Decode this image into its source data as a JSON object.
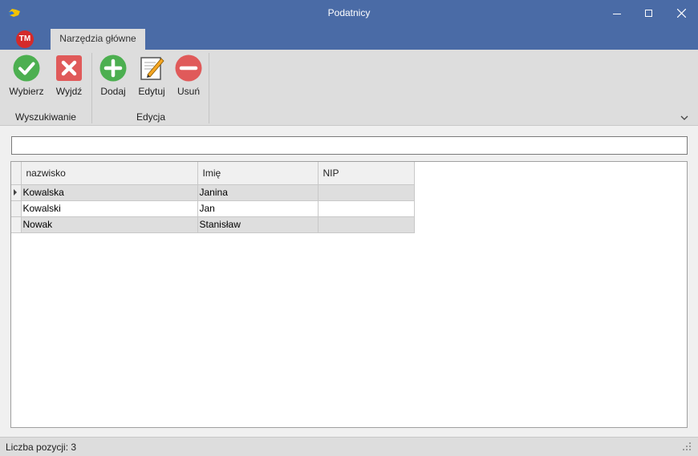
{
  "window": {
    "title": "Podatnicy",
    "icon": "app-icon",
    "controls": [
      "minimize-icon",
      "maximize-icon",
      "close-icon"
    ]
  },
  "ribbon": {
    "app_logo": "TM",
    "tabs": [
      {
        "label": "Narzędzia główne",
        "active": true
      }
    ],
    "groups": [
      {
        "label": "Wyszukiwanie",
        "buttons": [
          {
            "label": "Wybierz",
            "icon": "check-icon",
            "color": "#4caf50"
          },
          {
            "label": "Wyjdź",
            "icon": "close-x-icon",
            "color": "#e05a5a"
          }
        ]
      },
      {
        "label": "Edycja",
        "buttons": [
          {
            "label": "Dodaj",
            "icon": "plus-icon",
            "color": "#4caf50"
          },
          {
            "label": "Edytuj",
            "icon": "edit-pencil-icon",
            "color": "#f5a623"
          },
          {
            "label": "Usuń",
            "icon": "minus-icon",
            "color": "#e05a5a"
          }
        ]
      }
    ]
  },
  "search": {
    "value": "",
    "placeholder": ""
  },
  "grid": {
    "columns": [
      "nazwisko",
      "Imię",
      "NIP"
    ],
    "rows": [
      {
        "nazwisko": "Kowalska",
        "imie": "Janina",
        "nip": "",
        "current": true
      },
      {
        "nazwisko": "Kowalski",
        "imie": "Jan",
        "nip": ""
      },
      {
        "nazwisko": "Nowak",
        "imie": "Stanisław",
        "nip": ""
      }
    ]
  },
  "status": {
    "text": "Liczba pozycji: 3"
  },
  "colors": {
    "titlebar": "#4a6ba6",
    "ribbon": "#dddddd",
    "alt_row": "#dedede"
  }
}
